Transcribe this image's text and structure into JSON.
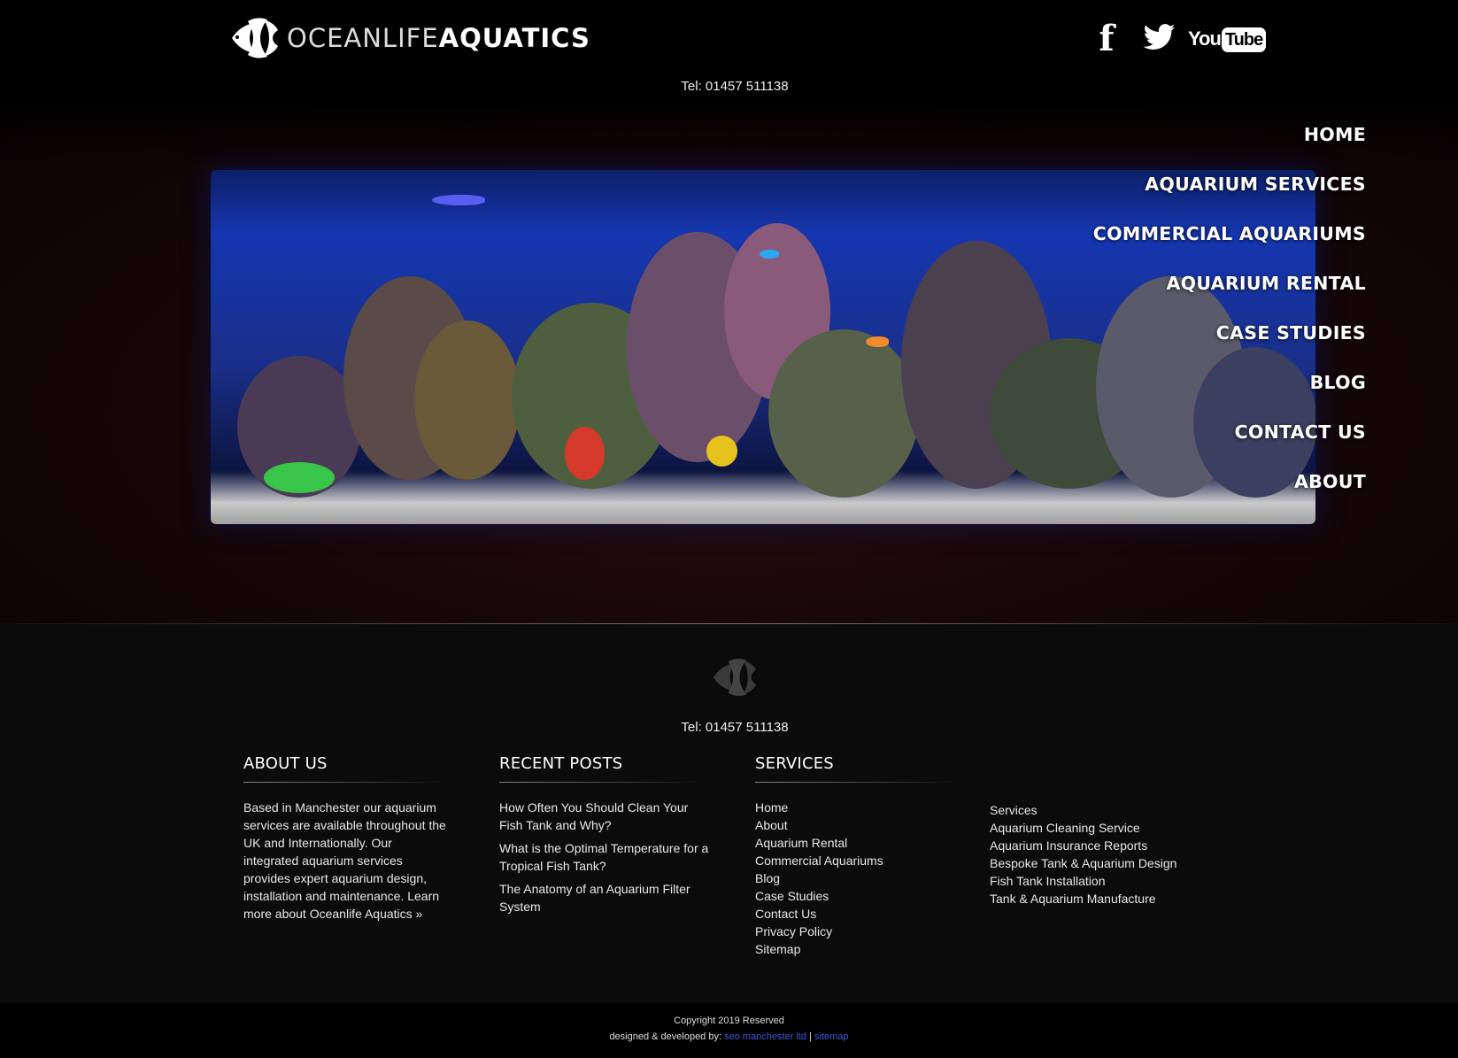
{
  "header": {
    "logo_light": "OCEANLIFE",
    "logo_bold": "AQUATICS",
    "tel": "Tel: 01457 511138",
    "social": [
      {
        "name": "facebook-icon",
        "glyph": "f"
      },
      {
        "name": "twitter-icon"
      },
      {
        "name": "youtube-icon",
        "you": "You",
        "tube": "Tube"
      }
    ]
  },
  "nav": {
    "items": [
      "HOME",
      "AQUARIUM SERVICES",
      "COMMERCIAL AQUARIUMS",
      "AQUARIUM RENTAL",
      "CASE STUDIES",
      "BLOG",
      "CONTACT US",
      "ABOUT"
    ]
  },
  "footer": {
    "tel": "Tel: 01457 511138",
    "about": {
      "heading": "ABOUT US",
      "text": "Based in Manchester our aquarium services are available throughout the UK and Internationally. Our integrated aquarium services provides expert aquarium design, installation and maintenance. Learn more about Oceanlife Aquatics »"
    },
    "posts": {
      "heading": "RECENT POSTS",
      "items": [
        "How Often You Should Clean Your Fish Tank and Why?",
        "What is the Optimal Temperature for a Tropical Fish Tank?",
        "The Anatomy of an Aquarium Filter System"
      ]
    },
    "services": {
      "heading": "SERVICES",
      "links": [
        "Home",
        "About",
        "Aquarium Rental",
        "Commercial Aquariums",
        "Blog",
        "Case Studies",
        "Contact Us",
        "Privacy Policy",
        "Sitemap"
      ],
      "links2": [
        "Services",
        "Aquarium Cleaning Service",
        "Aquarium Insurance Reports",
        "Bespoke Tank & Aquarium Design",
        "Fish Tank Installation",
        "Tank & Aquarium Manufacture"
      ]
    }
  },
  "bottom": {
    "copyright": "Copyright 2019 Reserved",
    "designed_by": "designed & developed by:",
    "seo_link": "seo manchester ltd",
    "separator": "|",
    "sitemap_link": "sitemap"
  },
  "colors": {
    "background": "#000000",
    "footer_bg": "#0b0b0b",
    "link_blue": "#3d57d6"
  }
}
